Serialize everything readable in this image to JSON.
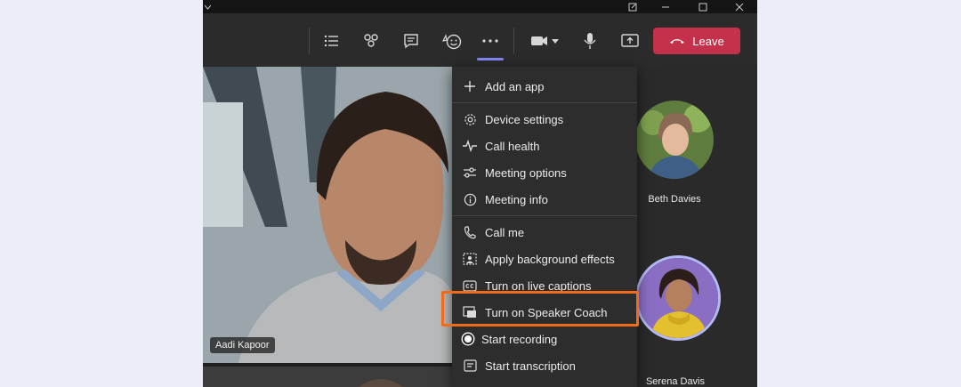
{
  "toolbar": {
    "buttons": [
      {
        "name": "participants-list"
      },
      {
        "name": "people"
      },
      {
        "name": "chat"
      },
      {
        "name": "reactions"
      },
      {
        "name": "more"
      }
    ],
    "leave_label": "Leave"
  },
  "participants": {
    "main": {
      "name": "Aadi Kapoor"
    },
    "side": [
      {
        "name": "Beth Davies"
      },
      {
        "name": "Serena Davis"
      }
    ]
  },
  "menu": {
    "items": [
      {
        "label": "Add an app",
        "icon": "plus-icon"
      },
      {
        "label": "Device settings",
        "icon": "gear-icon"
      },
      {
        "label": "Call health",
        "icon": "pulse-icon"
      },
      {
        "label": "Meeting options",
        "icon": "sliders-icon"
      },
      {
        "label": "Meeting info",
        "icon": "info-icon"
      },
      {
        "label": "Call me",
        "icon": "phone-icon"
      },
      {
        "label": "Apply background effects",
        "icon": "background-effects-icon"
      },
      {
        "label": "Turn on live captions",
        "icon": "cc-icon"
      },
      {
        "label": "Turn on Speaker Coach",
        "icon": "speaker-coach-icon"
      },
      {
        "label": "Start recording",
        "icon": "record-icon"
      },
      {
        "label": "Start transcription",
        "icon": "transcription-icon"
      }
    ],
    "highlighted": "Turn on Speaker Coach"
  },
  "colors": {
    "leave": "#c4314b",
    "highlight": "#f26a1b",
    "accent": "#7f85f5"
  }
}
